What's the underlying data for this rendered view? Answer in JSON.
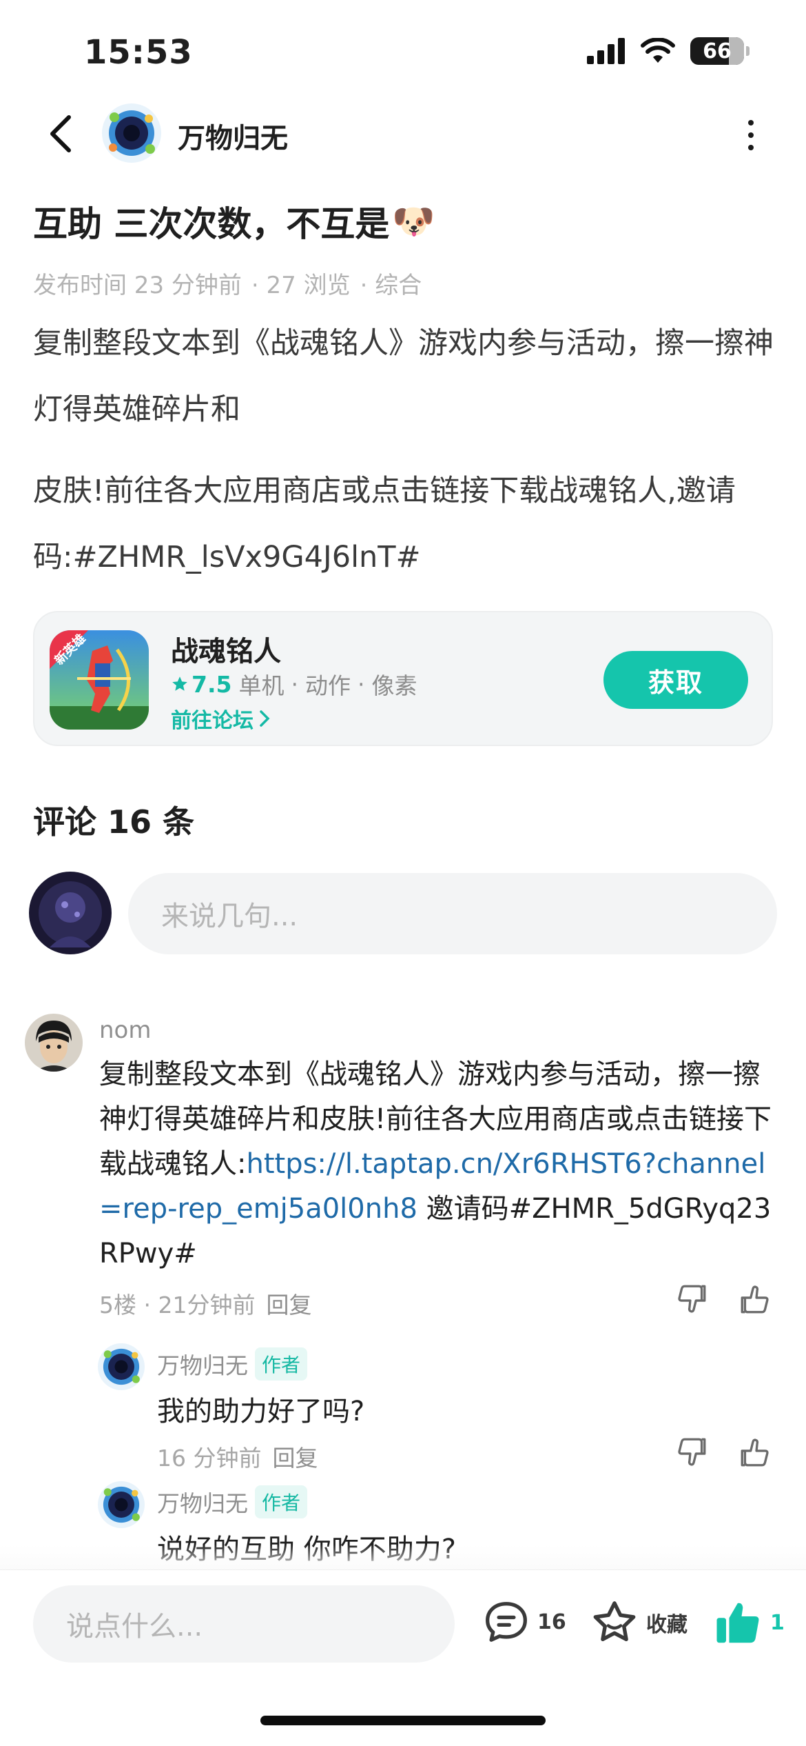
{
  "status_bar": {
    "time": "15:53",
    "battery": "66"
  },
  "nav": {
    "author_name": "万物归无"
  },
  "post": {
    "title": "互助 三次次数，不互是",
    "title_emoji": "🐶",
    "meta": {
      "published": "发布时间 23 分钟前",
      "views": "· 27 浏览",
      "category": "· 综合"
    },
    "body_1": "复制整段文本到《战魂铭人》游戏内参与活动，擦一擦神灯得英雄碎片和",
    "body_2": "皮肤!前往各大应用商店或点击链接下载战魂铭人,邀请码:#ZHMR_lsVx9G4J6lnT#"
  },
  "app_card": {
    "name": "战魂铭人",
    "rating": "7.5",
    "tags": [
      "单机",
      "动作",
      "像素"
    ],
    "forum_link": "前往论坛",
    "icon_badge": "新英雄",
    "get_button": "获取"
  },
  "comments": {
    "title": "评论 16 条",
    "input_placeholder": "来说几句...",
    "items": [
      {
        "user": "nom",
        "text_before_link": "复制整段文本到《战魂铭人》游戏内参与活动，擦一擦神灯得英雄碎片和皮肤!前往各大应用商店或点击链接下载战魂铭人:",
        "link": "https://l.taptap.cn/Xr6RHST6?channel=rep-rep_emj5a0l0nh8",
        "text_after_link": " 邀请码#ZHMR_5dGRyq23RPwy#",
        "floor_time": "5楼 · 21分钟前",
        "reply_label": "回复",
        "replies": [
          {
            "user": "万物归无",
            "badge": "作者",
            "text": "我的助力好了吗?",
            "time": "16 分钟前",
            "reply_label": "回复"
          },
          {
            "user": "万物归无",
            "badge": "作者",
            "text": "说好的互助 你咋不助力?"
          }
        ]
      }
    ]
  },
  "bottom_bar": {
    "input_placeholder": "说点什么...",
    "comment_count": "16",
    "favorite_label": "收藏",
    "like_count": "1"
  },
  "colors": {
    "accent": "#15c5ac",
    "link": "#1e6aa8",
    "muted": "#a6a6a6"
  }
}
